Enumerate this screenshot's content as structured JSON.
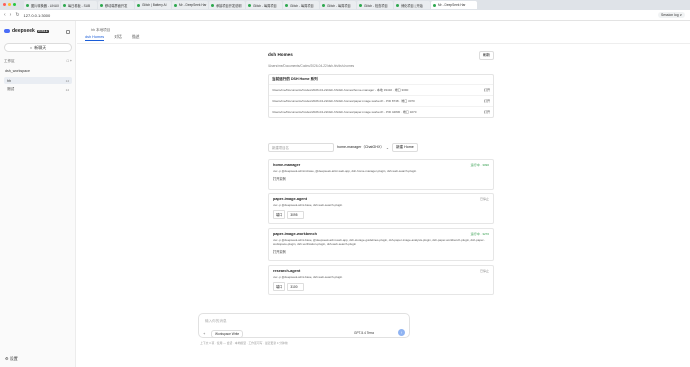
{
  "browser": {
    "tabs": [
      {
        "label": "图片转换器 - LINUX"
      },
      {
        "label": "每日看板 - SUB"
      },
      {
        "label": "移动端界面开发"
      },
      {
        "label": "Glitch | Battery AI"
      },
      {
        "label": "Mr - DeepSeek Har"
      },
      {
        "label": "承接项目开发说明"
      },
      {
        "label": "Glitch - 每周项目"
      },
      {
        "label": "Glitch - 每周项目"
      },
      {
        "label": "Glitch - 每周项目"
      },
      {
        "label": "Glitch - 检查项目"
      },
      {
        "label": "博化项目 | 开始"
      },
      {
        "label": "Mr - DeepSeek Har"
      }
    ],
    "url": "127.0.0.1:3000",
    "right_label": "Session log ∨"
  },
  "sidebar": {
    "brand": "deepseek",
    "badge": "MOBILE",
    "new_chat": "新聊天",
    "workspace_label": "工作区",
    "workspace_name": "dsh_workspace",
    "items": [
      {
        "label": "hh",
        "count": "14"
      },
      {
        "label": "测试",
        "count": "14"
      }
    ],
    "settings": "设置"
  },
  "main": {
    "project_title": "hh 本地项目",
    "tabs": [
      "dsh Homes",
      "对话",
      "描述"
    ],
    "section_title": "dsh Homes",
    "refresh": "刷新",
    "path": "/Users/me/Documents/Codex/2026-04-22/dsh-hh/dsh-homes",
    "existing": {
      "title": "当前运行的 DSH Home 系列",
      "rows": [
        {
          "path": "/Users/me/Documents/Codex/2026-04-22/dsh-hh/dsh-homes/home-manager - 本地 33432 · 端口 3090",
          "action": "打开"
        },
        {
          "path": "/Users/me/Documents/Codex/2026-04-22/dsh-hh/dsh-homes/paper-image-worker/rt - PID 8738 · 端口 3070",
          "action": "打开"
        },
        {
          "path": "/Users/me/Documents/Codex/2026-04-22/dsh-hh/dsh-homes/paper-image-worker/rt - PID 44830 · 端口 3270",
          "action": "打开"
        }
      ]
    },
    "controls": {
      "input_placeholder": "新建项目名",
      "template": "home-manager（ChatGHX）",
      "new_button": "新建 Home"
    },
    "cards": [
      {
        "name": "home-manager",
        "status": "运行中 · 3090",
        "status_ok": true,
        "cmd": "uvx -p @deepseek-ai/mini-base, @deepseek-ai/mi-web-app, dsh-home-manager-plugin, dsh-web-search-plugin",
        "link": "打开实例"
      },
      {
        "name": "paper-image-agent",
        "status": "已停止",
        "status_ok": false,
        "cmd": "uvx -p @deepseek-ai/mi-base, dsh-web-search-plugin",
        "port_label": "端口",
        "port_value": "3095"
      },
      {
        "name": "paper-image-workbench",
        "status": "运行中 · 3270",
        "status_ok": true,
        "cmd": "uvx -p @deepseek-ai/mi-base, @deepseek-ai/mi-web-app, dsh-storage-guidelines-plugin, dsh-paper-image-analysis-plugin, dsh-paper-workbench-plugin, dsh-paper-workspace-plugin, dsh-verification-plugin, dsh-web-search-plugin",
        "link": "打开实例"
      },
      {
        "name": "research-agent",
        "status": "已停止",
        "status_ok": false,
        "cmd": "uvx -p @deepseek-ai/mi-base, dsh-web-search-plugin",
        "port_label": "端口",
        "port_value": "3100"
      }
    ]
  },
  "composer": {
    "placeholder": "输入你的消息",
    "mode": "Workspace Write",
    "model": "GPT-5.4 Terra",
    "status": "上下文 3 项 · 使用 — 会话 · 本地模型 · 工作区可写 · 最近更新 4 分钟前"
  },
  "colors": {
    "accent": "#1a5dd8",
    "ok": "#2e9b49",
    "send": "#8fb3f2"
  }
}
